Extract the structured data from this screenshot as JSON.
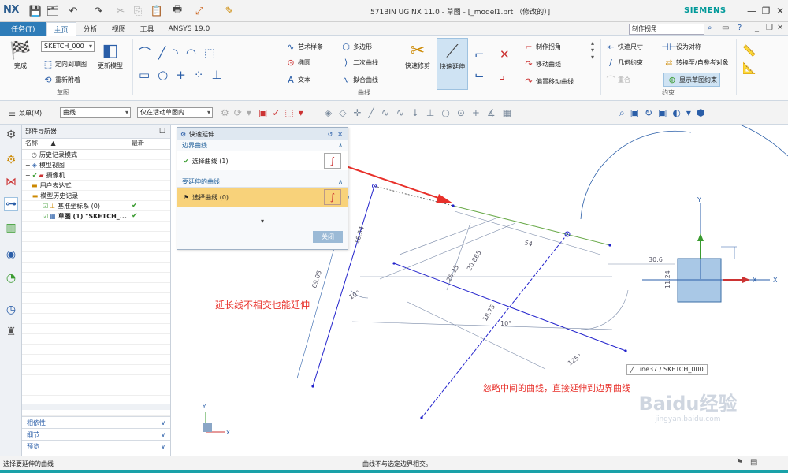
{
  "app": {
    "logo": "NX",
    "window_title": "571BIN UG NX 11.0 - 草图 - [_model1.prt （修改的）]",
    "brand": "SIEMENS"
  },
  "tabs": [
    "任务(T)",
    "主页",
    "分析",
    "视图",
    "工具",
    "ANSYS 19.0"
  ],
  "search": {
    "value": "制作拐角"
  },
  "ribbon": {
    "sketch_group": {
      "label": "草图",
      "finish": "完成",
      "sketch_name": "SKETCH_000",
      "orient": "定向到草图",
      "reattach": "重新附着",
      "update_model": "更新模型"
    },
    "curve_group": {
      "label": "曲线",
      "art_spline": "艺术样条",
      "polygon": "多边形",
      "ellipse": "椭圆",
      "conic": "二次曲线",
      "text": "文本",
      "fit_curve": "拟合曲线",
      "quick_trim": "快速修剪",
      "quick_extend": "快速延伸",
      "make_corner": "制作拐角",
      "move_curve": "移动曲线",
      "offset_move_curve": "偏置移动曲线"
    },
    "constraint_group": {
      "label": "约束",
      "quick_dim": "快速尺寸",
      "make_symmetric": "设为对称",
      "geo_constraint": "几何约束",
      "convert_ref": "转换至/自参考对象",
      "sketch_constraints": "显示草图约束",
      "faded": "重合"
    }
  },
  "toolbar2": {
    "menu": "菜单(M)",
    "filter": "曲线",
    "scope": "仅在活动草图内"
  },
  "navigator": {
    "title": "部件导航器",
    "col_name": "名称",
    "col_latest": "最新",
    "items": [
      {
        "label": "历史记录模式",
        "latest": ""
      },
      {
        "label": "模型视图",
        "latest": ""
      },
      {
        "label": "摄像机",
        "latest": ""
      },
      {
        "label": "用户表达式",
        "latest": ""
      },
      {
        "label": "模型历史记录",
        "latest": ""
      },
      {
        "label": "基准坐标系 (0)",
        "latest": "✔"
      },
      {
        "label": "草图 (1) \"SKETCH_...",
        "latest": "✔"
      }
    ],
    "accordions": [
      "相依性",
      "细节",
      "预览"
    ]
  },
  "dialog": {
    "title": "快速延伸",
    "section1": "边界曲线",
    "select1": "选择曲线 (1)",
    "section2": "要延伸的曲线",
    "select2": "选择曲线 (0)",
    "close": "关闭"
  },
  "canvas": {
    "annotation1": "延长线不相交也能延伸",
    "annotation2": "忽略中间的曲线，直接延伸到边界曲线",
    "tooltip": "Line37 / SKETCH_000",
    "dims": [
      "54",
      "30.6",
      "16.34",
      "69.05",
      "10°",
      "26.25",
      "20.865",
      "18.75",
      "11.24",
      "125°",
      "10°"
    ],
    "axis_x": "X",
    "axis_y": "Y"
  },
  "status": {
    "left": "选择要延伸的曲线",
    "center": "曲线不与选定边界相交。"
  },
  "watermark": {
    "brand": "Baidu经验",
    "url": "jingyan.baidu.com"
  },
  "colors": {
    "accent": "#2e7cb8",
    "annotation": "#e8302a",
    "sketch_blue": "#2222cc",
    "teal": "#1aa1a8"
  }
}
